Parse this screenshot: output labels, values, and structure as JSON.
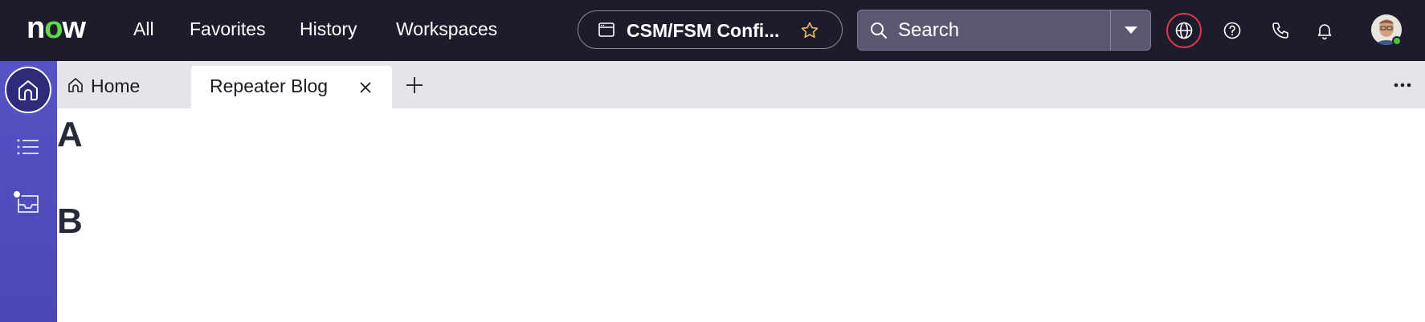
{
  "header": {
    "logo_text_n": "n",
    "logo_text_o": "o",
    "logo_text_w": "w",
    "nav": [
      {
        "label": "All"
      },
      {
        "label": "Favorites"
      },
      {
        "label": "History"
      },
      {
        "label": "Workspaces"
      }
    ],
    "context_title": "CSM/FSM Confi...",
    "search": {
      "placeholder": "Search",
      "value": ""
    },
    "icons": [
      "globe-icon",
      "help-icon",
      "phone-icon",
      "bell-icon"
    ],
    "colors": {
      "bg": "#1c1c2c",
      "accent_ring": "#e8344a",
      "logo_o": "#62d84e",
      "status_online": "#4cc13a"
    }
  },
  "rail": {
    "items": [
      "home-icon",
      "list-icon",
      "inbox-icon"
    ],
    "color": "#5654c4"
  },
  "tabs": {
    "items": [
      {
        "label": "Home"
      },
      {
        "label": "Repeater Blog"
      }
    ]
  },
  "content": {
    "headings": [
      "A",
      "B"
    ]
  }
}
